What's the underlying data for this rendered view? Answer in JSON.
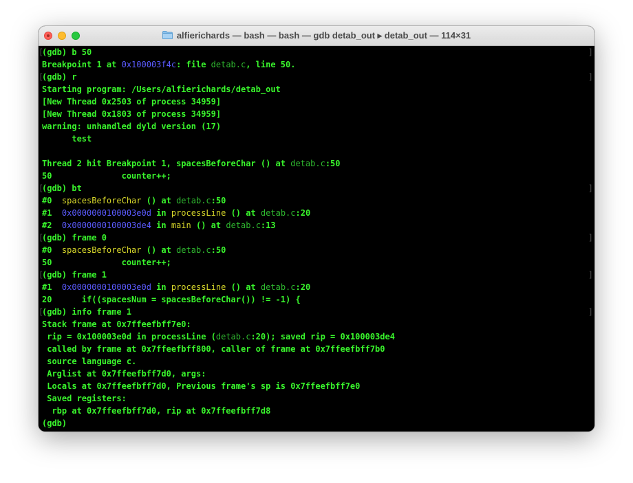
{
  "window": {
    "title": "alfierichards — bash — bash — gdb detab_out ▸ detab_out — 114×31",
    "colors": {
      "text": "#39f52c",
      "address": "#5b5bff",
      "filename": "#2fb82f",
      "function": "#d6d62a",
      "background": "#000000"
    }
  },
  "terminal": {
    "lines": [
      {
        "prompt": true,
        "segments": [
          {
            "t": "(gdb) b 50",
            "c": ""
          }
        ]
      },
      {
        "prompt": false,
        "segments": [
          {
            "t": "Breakpoint 1 at ",
            "c": ""
          },
          {
            "t": "0x100003f4c",
            "c": "addr"
          },
          {
            "t": ": file ",
            "c": ""
          },
          {
            "t": "detab.c",
            "c": "file"
          },
          {
            "t": ", line 50.",
            "c": ""
          }
        ]
      },
      {
        "prompt": true,
        "segments": [
          {
            "t": "(gdb) r",
            "c": ""
          }
        ]
      },
      {
        "prompt": false,
        "segments": [
          {
            "t": "Starting program: /Users/alfierichards/detab_out",
            "c": ""
          }
        ]
      },
      {
        "prompt": false,
        "segments": [
          {
            "t": "[New Thread 0x2503 of process 34959]",
            "c": ""
          }
        ]
      },
      {
        "prompt": false,
        "segments": [
          {
            "t": "[New Thread 0x1803 of process 34959]",
            "c": ""
          }
        ]
      },
      {
        "prompt": false,
        "segments": [
          {
            "t": "warning: unhandled dyld version (17)",
            "c": ""
          }
        ]
      },
      {
        "prompt": false,
        "segments": [
          {
            "t": "      test",
            "c": ""
          }
        ]
      },
      {
        "prompt": false,
        "segments": [
          {
            "t": "",
            "c": ""
          }
        ]
      },
      {
        "prompt": false,
        "segments": [
          {
            "t": "Thread 2 hit Breakpoint 1, spacesBeforeChar () at ",
            "c": ""
          },
          {
            "t": "detab.c",
            "c": "file"
          },
          {
            "t": ":50",
            "c": ""
          }
        ]
      },
      {
        "prompt": false,
        "segments": [
          {
            "t": "50              counter++;",
            "c": ""
          }
        ]
      },
      {
        "prompt": true,
        "segments": [
          {
            "t": "(gdb) bt",
            "c": ""
          }
        ]
      },
      {
        "prompt": false,
        "segments": [
          {
            "t": "#0  ",
            "c": ""
          },
          {
            "t": "spacesBeforeChar",
            "c": "fn"
          },
          {
            "t": " () at ",
            "c": ""
          },
          {
            "t": "detab.c",
            "c": "file"
          },
          {
            "t": ":50",
            "c": ""
          }
        ]
      },
      {
        "prompt": false,
        "segments": [
          {
            "t": "#1  ",
            "c": ""
          },
          {
            "t": "0x0000000100003e0d",
            "c": "addr"
          },
          {
            "t": " in ",
            "c": ""
          },
          {
            "t": "processLine",
            "c": "fn"
          },
          {
            "t": " () at ",
            "c": ""
          },
          {
            "t": "detab.c",
            "c": "file"
          },
          {
            "t": ":20",
            "c": ""
          }
        ]
      },
      {
        "prompt": false,
        "segments": [
          {
            "t": "#2  ",
            "c": ""
          },
          {
            "t": "0x0000000100003de4",
            "c": "addr"
          },
          {
            "t": " in ",
            "c": ""
          },
          {
            "t": "main",
            "c": "fn"
          },
          {
            "t": " () at ",
            "c": ""
          },
          {
            "t": "detab.c",
            "c": "file"
          },
          {
            "t": ":13",
            "c": ""
          }
        ]
      },
      {
        "prompt": true,
        "segments": [
          {
            "t": "(gdb) frame 0",
            "c": ""
          }
        ]
      },
      {
        "prompt": false,
        "segments": [
          {
            "t": "#0  ",
            "c": ""
          },
          {
            "t": "spacesBeforeChar",
            "c": "fn"
          },
          {
            "t": " () at ",
            "c": ""
          },
          {
            "t": "detab.c",
            "c": "file"
          },
          {
            "t": ":50",
            "c": ""
          }
        ]
      },
      {
        "prompt": false,
        "segments": [
          {
            "t": "50              counter++;",
            "c": ""
          }
        ]
      },
      {
        "prompt": true,
        "segments": [
          {
            "t": "(gdb) frame 1",
            "c": ""
          }
        ]
      },
      {
        "prompt": false,
        "segments": [
          {
            "t": "#1  ",
            "c": ""
          },
          {
            "t": "0x0000000100003e0d",
            "c": "addr"
          },
          {
            "t": " in ",
            "c": ""
          },
          {
            "t": "processLine",
            "c": "fn"
          },
          {
            "t": " () at ",
            "c": ""
          },
          {
            "t": "detab.c",
            "c": "file"
          },
          {
            "t": ":20",
            "c": ""
          }
        ]
      },
      {
        "prompt": false,
        "segments": [
          {
            "t": "20      if((spacesNum = spacesBeforeChar()) != -1) {",
            "c": ""
          }
        ]
      },
      {
        "prompt": true,
        "segments": [
          {
            "t": "(gdb) info frame 1",
            "c": ""
          }
        ]
      },
      {
        "prompt": false,
        "segments": [
          {
            "t": "Stack frame at 0x7ffeefbff7e0:",
            "c": ""
          }
        ]
      },
      {
        "prompt": false,
        "segments": [
          {
            "t": " rip = 0x100003e0d in processLine (",
            "c": ""
          },
          {
            "t": "detab.c",
            "c": "file"
          },
          {
            "t": ":20); saved rip = 0x100003de4",
            "c": ""
          }
        ]
      },
      {
        "prompt": false,
        "segments": [
          {
            "t": " called by frame at 0x7ffeefbff800, caller of frame at 0x7ffeefbff7b0",
            "c": ""
          }
        ]
      },
      {
        "prompt": false,
        "segments": [
          {
            "t": " source language c.",
            "c": ""
          }
        ]
      },
      {
        "prompt": false,
        "segments": [
          {
            "t": " Arglist at 0x7ffeefbff7d0, args: ",
            "c": ""
          }
        ]
      },
      {
        "prompt": false,
        "segments": [
          {
            "t": " Locals at 0x7ffeefbff7d0, Previous frame's sp is 0x7ffeefbff7e0",
            "c": ""
          }
        ]
      },
      {
        "prompt": false,
        "segments": [
          {
            "t": " Saved registers:",
            "c": ""
          }
        ]
      },
      {
        "prompt": false,
        "segments": [
          {
            "t": "  rbp at 0x7ffeefbff7d0, rip at 0x7ffeefbff7d8",
            "c": ""
          }
        ]
      },
      {
        "prompt": false,
        "segments": [
          {
            "t": "(gdb) ",
            "c": ""
          }
        ]
      }
    ]
  }
}
